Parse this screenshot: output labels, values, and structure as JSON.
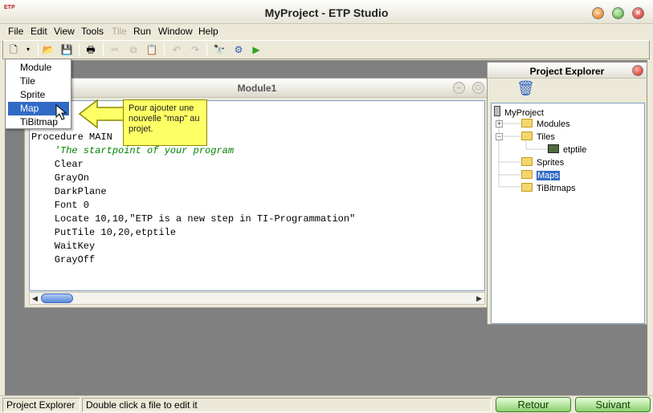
{
  "window": {
    "title": "MyProject - ETP Studio",
    "logo": "ETP"
  },
  "menu": {
    "items": [
      "File",
      "Edit",
      "View",
      "Tools",
      "Tile",
      "Run",
      "Window",
      "Help"
    ]
  },
  "dropdown": {
    "items": [
      "Module",
      "Tile",
      "Sprite",
      "Map",
      "TiBitmap"
    ],
    "selected": "Map"
  },
  "callout": {
    "text": "Pour ajouter une nouvelle \"map\" au projet."
  },
  "editor": {
    "title": "Module1",
    "lines": [
      "Procedure MAIN",
      "    'The startpoint of your program",
      "    Clear",
      "    GrayOn",
      "    DarkPlane",
      "    Font 0",
      "    Locate 10,10,\"ETP is a new step in TI-Programmation\"",
      "    PutTile 10,20,etptile",
      "    WaitKey",
      "    GrayOff"
    ]
  },
  "explorer": {
    "title": "Project Explorer",
    "root": "MyProject",
    "items": {
      "modules": "Modules",
      "tiles": "Tiles",
      "etptile": "etptile",
      "sprites": "Sprites",
      "maps": "Maps",
      "tibitmaps": "TiBitmaps"
    }
  },
  "status": {
    "panel1": "Project Explorer",
    "panel2": "Double click a file to edit it",
    "back": "Retour",
    "next": "Suivant"
  },
  "colors": {
    "selection": "#316ac5",
    "callout": "#ffff66"
  },
  "icons": [
    "new-file-icon",
    "open-folder-icon",
    "save-icon",
    "print-icon",
    "cut-icon",
    "copy-icon",
    "paste-icon",
    "undo-icon",
    "redo-icon",
    "find-icon",
    "settings-icon",
    "run-icon",
    "trash-icon"
  ]
}
